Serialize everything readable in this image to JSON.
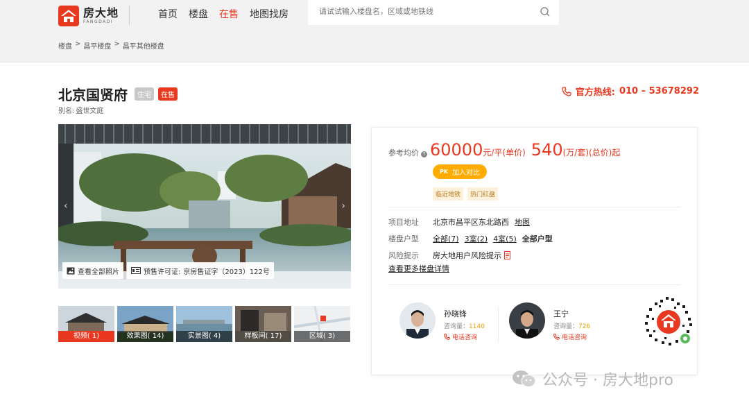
{
  "header": {
    "logo_cn": "房大地",
    "logo_en": "FANGDADI",
    "nav": [
      "首页",
      "楼盘",
      "在售",
      "地图找房"
    ],
    "active_nav": "在售",
    "search_placeholder": "请试试输入楼盘名，区域或地铁线"
  },
  "breadcrumb": [
    "楼盘",
    ">",
    "昌平楼盘",
    ">",
    "昌平其他楼盘"
  ],
  "project": {
    "title": "北京国贤府",
    "tag_type": "住宅",
    "tag_status": "在售",
    "alias_label": "别名:",
    "alias": "盛世文庭",
    "hotline_label": "官方热线:",
    "hotline": "010 – 53678292"
  },
  "gallery": {
    "all_photos": "查看全部照片",
    "permit_label": "预售许可证:",
    "permit": "京房售证字（2023）122号",
    "thumbs": [
      {
        "label": "视频( 1)",
        "highlight": true
      },
      {
        "label": "效果图( 14)",
        "highlight": false
      },
      {
        "label": "实景图( 4)",
        "highlight": false
      },
      {
        "label": "样板间( 17)",
        "highlight": false
      },
      {
        "label": "区域( 3)",
        "highlight": false
      }
    ]
  },
  "price": {
    "label": "参考均价",
    "unit_price": "60000",
    "unit_price_suffix": "元/平(单价)",
    "total_price": "540",
    "total_price_suffix": "(万/套)(总价)起",
    "compare_badge": "PK",
    "compare_label": "加入对比",
    "tags": [
      "临近地铁",
      "热门红盘"
    ]
  },
  "info": {
    "address_label": "项目地址",
    "address": "北京市昌平区东北路西",
    "map_link": "地图",
    "house_type_label": "楼盘户型",
    "house_types": [
      "全部(7)",
      "3室(2)",
      "4室(5)"
    ],
    "house_types_all": "全部户型",
    "risk_label": "风险提示",
    "risk": "房大地用户风险提示",
    "more_link": "查看更多楼盘详情"
  },
  "agents": [
    {
      "name": "孙晓锋",
      "inquiries_label": "咨询量：",
      "inquiries": "1140",
      "call": "电话咨询"
    },
    {
      "name": "王宁",
      "inquiries_label": "咨询量：",
      "inquiries": "726",
      "call": "电话咨询"
    }
  ],
  "watermark": "公众号 · 房大地pro",
  "colors": {
    "brand_red": "#e8381f",
    "accent_orange": "#ffab00",
    "tag_gold": "#b07a1a"
  }
}
